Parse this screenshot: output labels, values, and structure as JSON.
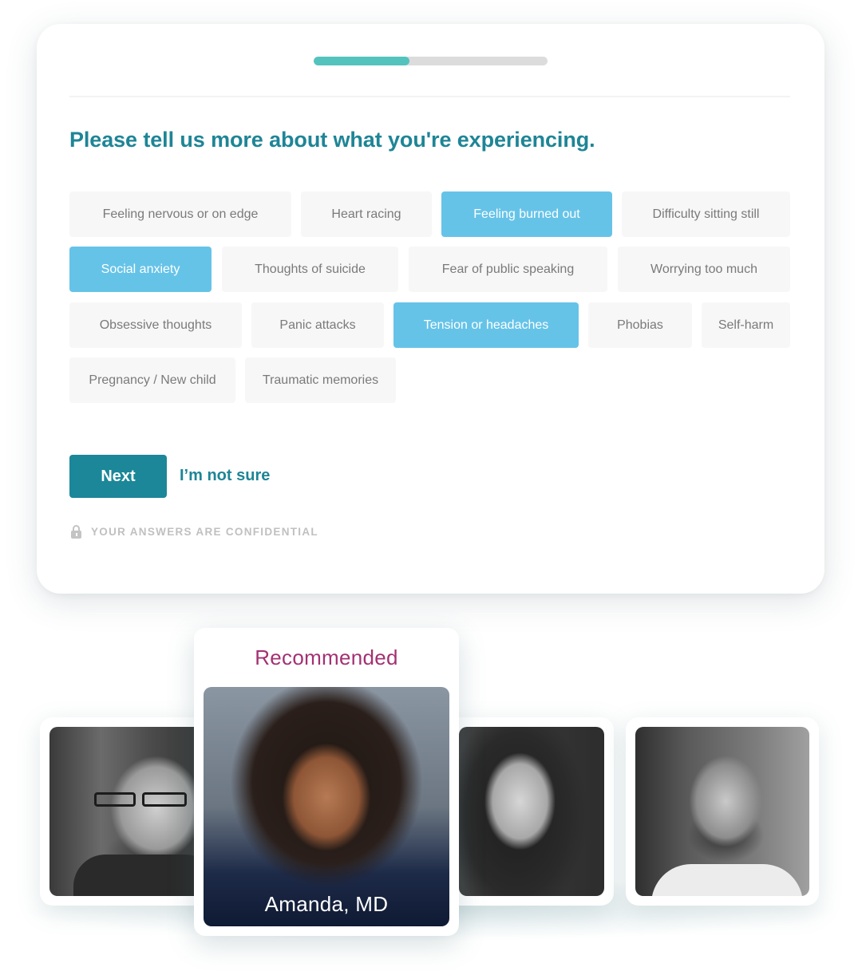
{
  "progress": {
    "value_percent": 41
  },
  "question": {
    "title": "Please tell us more about what you're experiencing."
  },
  "options": [
    {
      "label": "Feeling nervous or on edge",
      "selected": false
    },
    {
      "label": "Heart racing",
      "selected": false
    },
    {
      "label": "Feeling burned out",
      "selected": true
    },
    {
      "label": "Difficulty sitting still",
      "selected": false
    },
    {
      "label": "Social anxiety",
      "selected": true
    },
    {
      "label": "Thoughts of suicide",
      "selected": false
    },
    {
      "label": "Fear of public speaking",
      "selected": false
    },
    {
      "label": "Worrying too much",
      "selected": false
    },
    {
      "label": "Obsessive thoughts",
      "selected": false
    },
    {
      "label": "Panic attacks",
      "selected": false
    },
    {
      "label": "Tension or headaches",
      "selected": true
    },
    {
      "label": "Phobias",
      "selected": false
    },
    {
      "label": "Self-harm",
      "selected": false
    },
    {
      "label": "Pregnancy / New child",
      "selected": false
    },
    {
      "label": "Traumatic memories",
      "selected": false
    }
  ],
  "actions": {
    "next_label": "Next",
    "not_sure_label": "I’m not sure"
  },
  "confidential": {
    "icon": "lock-icon",
    "text": "YOUR ANSWERS ARE CONFIDENTIAL"
  },
  "providers": {
    "recommended_label": "Recommended",
    "recommended_name": "Amanda, MD"
  },
  "colors": {
    "accent": "#1e8596",
    "progress": "#54c3be",
    "selected_chip": "#66c3e8",
    "recommended": "#a33171"
  }
}
